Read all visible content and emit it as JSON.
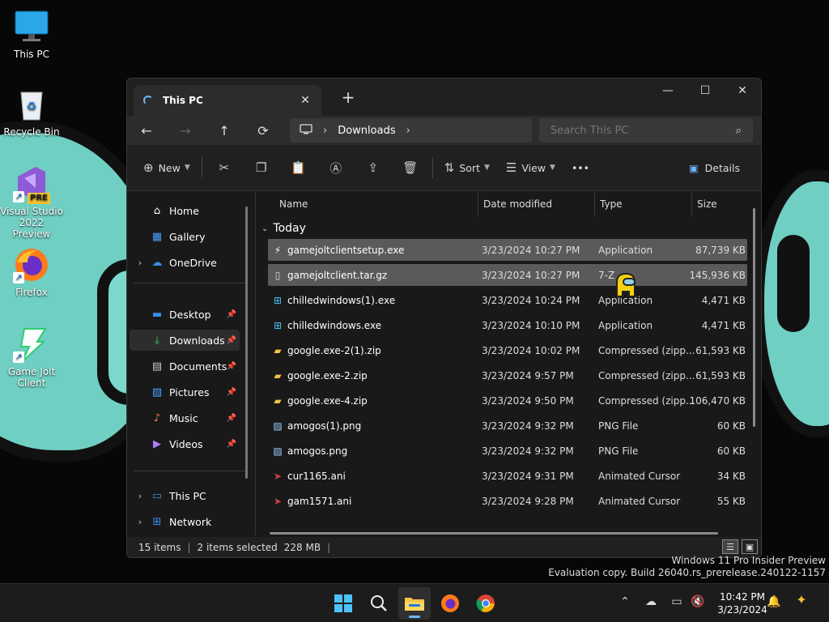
{
  "desktop": {
    "icons": [
      {
        "label": "This PC",
        "icon": "monitor-icon"
      },
      {
        "label": "Recycle Bin",
        "icon": "recycle-bin-icon"
      },
      {
        "label": "Visual Studio 2022 Preview",
        "icon": "visual-studio-icon",
        "badge": "PRE"
      },
      {
        "label": "Firefox",
        "icon": "firefox-icon"
      },
      {
        "label": "Game Jolt Client",
        "icon": "game-jolt-icon"
      }
    ],
    "colors": {
      "wallpaper_accent": "#6fcfc2",
      "wallpaper_bg": "#070707"
    }
  },
  "window": {
    "tab_title": "This PC",
    "tab_close": "✕",
    "new_tab": "+",
    "controls": {
      "minimize": "—",
      "maximize": "☐",
      "close": "✕"
    },
    "breadcrumb": {
      "root_icon": "monitor-icon",
      "items": [
        "Downloads"
      ]
    },
    "search_placeholder": "Search This PC",
    "commands": {
      "new": "New",
      "sort": "Sort",
      "view": "View",
      "more": "•••",
      "details": "Details"
    },
    "nav": {
      "items": [
        {
          "label": "Home",
          "icon": "home-icon"
        },
        {
          "label": "Gallery",
          "icon": "gallery-icon"
        },
        {
          "label": "OneDrive",
          "icon": "onedrive-icon",
          "expandable": true
        },
        {
          "label": "Desktop",
          "icon": "desktop-folder-icon",
          "pinned": true
        },
        {
          "label": "Downloads",
          "icon": "downloads-icon",
          "pinned": true,
          "selected": true
        },
        {
          "label": "Documents",
          "icon": "documents-icon",
          "pinned": true
        },
        {
          "label": "Pictures",
          "icon": "pictures-icon",
          "pinned": true
        },
        {
          "label": "Music",
          "icon": "music-icon",
          "pinned": true
        },
        {
          "label": "Videos",
          "icon": "videos-icon",
          "pinned": true
        },
        {
          "label": "This PC",
          "icon": "this-pc-icon",
          "expandable": true
        },
        {
          "label": "Network",
          "icon": "network-icon",
          "expandable": true
        }
      ]
    },
    "columns": {
      "name": "Name",
      "date": "Date modified",
      "type": "Type",
      "size": "Size"
    },
    "group": "Today",
    "files": [
      {
        "name": "gamejoltclientsetup.exe",
        "date": "3/23/2024 10:27 PM",
        "type": "Application",
        "size": "87,739 KB",
        "icon": "game-jolt-icon",
        "selected": true
      },
      {
        "name": "gamejoltclient.tar.gz",
        "date": "3/23/2024 10:27 PM",
        "type": "7-Z",
        "size": "145,936 KB",
        "icon": "file-icon",
        "selected": true
      },
      {
        "name": "chilledwindows(1).exe",
        "date": "3/23/2024 10:24 PM",
        "type": "Application",
        "size": "4,471 KB",
        "icon": "windows-app-icon"
      },
      {
        "name": "chilledwindows.exe",
        "date": "3/23/2024 10:10 PM",
        "type": "Application",
        "size": "4,471 KB",
        "icon": "windows-app-icon"
      },
      {
        "name": "google.exe-2(1).zip",
        "date": "3/23/2024 10:02 PM",
        "type": "Compressed (zipp...",
        "size": "61,593 KB",
        "icon": "zip-folder-icon"
      },
      {
        "name": "google.exe-2.zip",
        "date": "3/23/2024 9:57 PM",
        "type": "Compressed (zipp...",
        "size": "61,593 KB",
        "icon": "zip-folder-icon"
      },
      {
        "name": "google.exe-4.zip",
        "date": "3/23/2024 9:50 PM",
        "type": "Compressed (zipp...",
        "size": "106,470 KB",
        "icon": "zip-folder-icon"
      },
      {
        "name": "amogos(1).png",
        "date": "3/23/2024 9:32 PM",
        "type": "PNG File",
        "size": "60 KB",
        "icon": "image-file-icon"
      },
      {
        "name": "amogos.png",
        "date": "3/23/2024 9:32 PM",
        "type": "PNG File",
        "size": "60 KB",
        "icon": "image-file-icon"
      },
      {
        "name": "cur1165.ani",
        "date": "3/23/2024 9:31 PM",
        "type": "Animated Cursor",
        "size": "34 KB",
        "icon": "cursor-icon"
      },
      {
        "name": "gam1571.ani",
        "date": "3/23/2024 9:28 PM",
        "type": "Animated Cursor",
        "size": "55 KB",
        "icon": "cursor-icon"
      }
    ],
    "status": {
      "count": "15 items",
      "selected": "2 items selected",
      "size": "228 MB"
    }
  },
  "watermark": {
    "line1": "Windows 11 Pro Insider Preview",
    "line2": "Evaluation copy. Build 26040.rs_prerelease.240122-1157"
  },
  "taskbar": {
    "apps": [
      "start-icon",
      "search-icon",
      "file-explorer-icon",
      "firefox-icon",
      "chrome-icon"
    ],
    "clock_time": "10:42 PM",
    "clock_date": "3/23/2024"
  }
}
